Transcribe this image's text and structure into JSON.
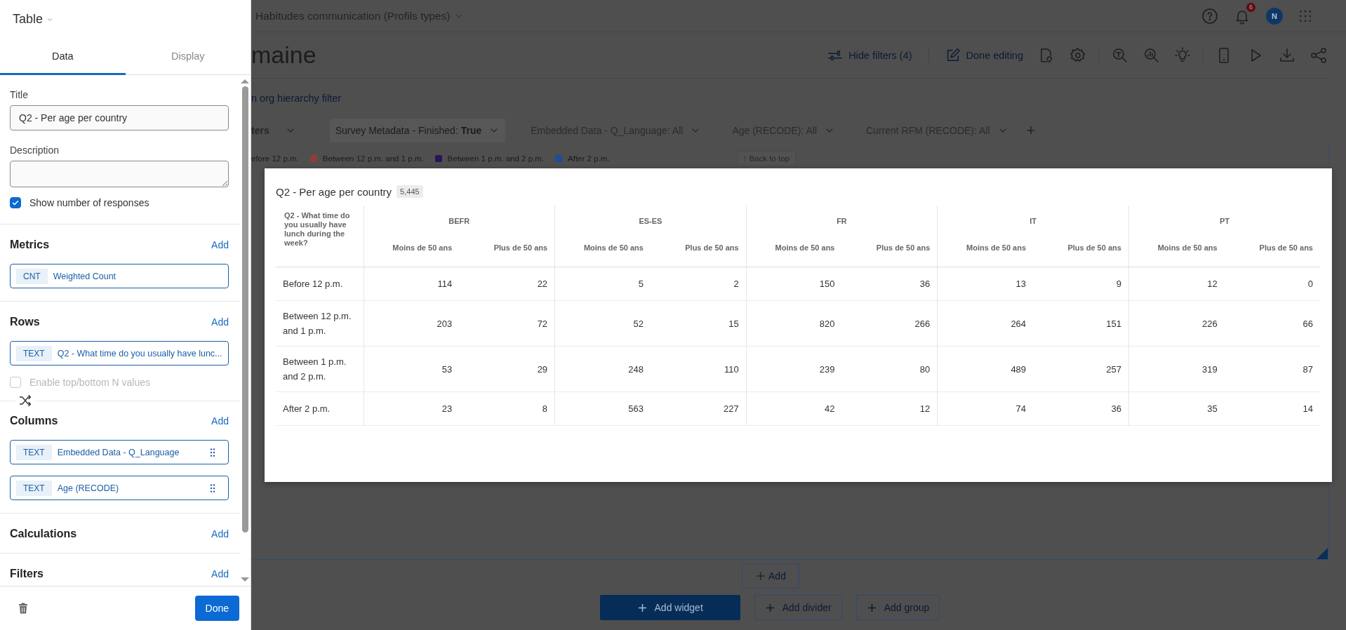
{
  "panel": {
    "title": "Table",
    "tabs": [
      {
        "label": "Data",
        "selected": true
      },
      {
        "label": "Display",
        "selected": false
      }
    ],
    "title_field": {
      "label": "Title",
      "value": "Q2 - Per age per country"
    },
    "description_field": {
      "label": "Description"
    },
    "show_responses": {
      "label": "Show number of responses",
      "checked": true
    },
    "sections": [
      {
        "heading": "Metrics",
        "add": "Add",
        "items": [
          {
            "tag": "CNT",
            "label": "Weighted Count",
            "draggable": false
          }
        ]
      },
      {
        "heading": "Rows",
        "add": "Add",
        "items": [
          {
            "tag": "TEXT",
            "label": "Q2 - What time do you usually have lunc...",
            "draggable": false
          }
        ],
        "option": {
          "label": "Enable top/bottom N values",
          "checked": false,
          "disabled": true
        }
      },
      {
        "heading": "Columns",
        "add": "Add",
        "swap": true,
        "items": [
          {
            "tag": "TEXT",
            "label": "Embedded Data - Q_Language",
            "draggable": true
          },
          {
            "tag": "TEXT",
            "label": "Age (RECODE)",
            "draggable": true
          }
        ]
      },
      {
        "heading": "Calculations",
        "add": "Add"
      },
      {
        "heading": "Filters",
        "add": "Add"
      }
    ],
    "done": "Done"
  },
  "page": {
    "survey_menu": "Habitudes communication (Profils types)",
    "notifications": "6",
    "avatar": "N",
    "title": "maine",
    "hide_filters": "Hide filters (4)",
    "done_editing": "Done editing",
    "org_filter_link": "n org hierarchy filter",
    "filters": [
      {
        "label": "ters",
        "kind": "menu"
      },
      {
        "label": "Survey Metadata - Finished: **True**",
        "kind": "chip"
      },
      {
        "label": "Embedded Data - Q_Language: All",
        "kind": "dropdown"
      },
      {
        "label": "Age (RECODE): All",
        "kind": "dropdown"
      },
      {
        "label": "Current RFM (RECODE): All",
        "kind": "dropdown"
      }
    ],
    "add_filter": "+",
    "legend": [
      {
        "label": "efore 12 p.m."
      },
      {
        "label": "Between 12 p.m. and 1 p.m.",
        "color": "#913c3c"
      },
      {
        "label": "Between 1 p.m. and 2 p.m.",
        "color": "#2a1458"
      },
      {
        "label": "After 2 p.m.",
        "color": "#1a4f9a"
      }
    ],
    "back_to_top": "↑ Back to top",
    "add_button": "Add",
    "widget_buttons": [
      {
        "label": "Add widget",
        "kind": "primary"
      },
      {
        "label": "Add divider",
        "kind": "outline"
      },
      {
        "label": "Add group",
        "kind": "outline"
      }
    ]
  },
  "table_card": {
    "title": "Q2 - Per age per country",
    "count": "5,445",
    "corner": "Q2 - What time do you usually have lunch during the week?",
    "groups": [
      {
        "label": "BEFR",
        "columns": [
          "Moins de 50 ans",
          "Plus de 50 ans"
        ]
      },
      {
        "label": "ES-ES",
        "columns": [
          "Moins de 50 ans",
          "Plus de 50 ans"
        ]
      },
      {
        "label": "FR",
        "columns": [
          "Moins de 50 ans",
          "Plus de 50 ans"
        ]
      },
      {
        "label": "IT",
        "columns": [
          "Moins de 50 ans",
          "Plus de 50 ans"
        ]
      },
      {
        "label": "PT",
        "columns": [
          "Moins de 50 ans",
          "Plus de 50 ans"
        ]
      }
    ],
    "rows": [
      {
        "label": "Before 12 p.m.",
        "cells": [
          "114",
          "22",
          "5",
          "2",
          "150",
          "36",
          "13",
          "9",
          "12",
          "0"
        ]
      },
      {
        "label": "Between 12 p.m. and 1 p.m.",
        "cells": [
          "203",
          "72",
          "52",
          "15",
          "820",
          "266",
          "264",
          "151",
          "226",
          "66"
        ]
      },
      {
        "label": "Between 1 p.m. and 2 p.m.",
        "cells": [
          "53",
          "29",
          "248",
          "110",
          "239",
          "80",
          "489",
          "257",
          "319",
          "87"
        ]
      },
      {
        "label": "After 2 p.m.",
        "cells": [
          "23",
          "8",
          "563",
          "227",
          "42",
          "12",
          "74",
          "36",
          "35",
          "14"
        ]
      }
    ]
  }
}
